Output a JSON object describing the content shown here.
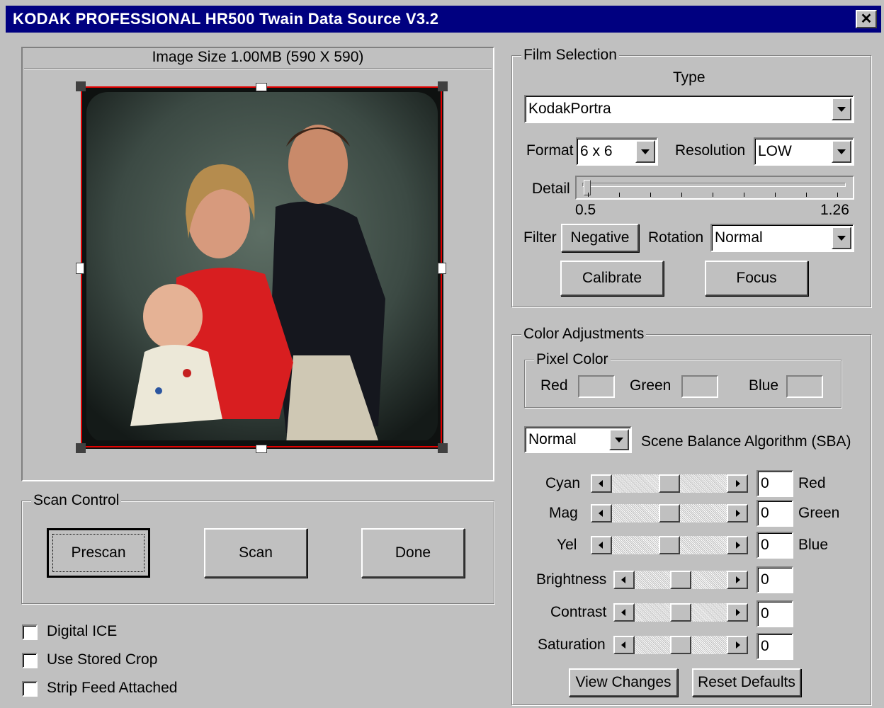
{
  "window": {
    "title": "KODAK PROFESSIONAL HR500 Twain Data Source V3.2",
    "close_glyph": "✕"
  },
  "preview": {
    "image_size_label": "Image Size 1.00MB (590 X 590)"
  },
  "scan_control": {
    "legend": "Scan Control",
    "prescan_label": "Prescan",
    "scan_label": "Scan",
    "done_label": "Done"
  },
  "options": {
    "digital_ice_label": "Digital ICE",
    "digital_ice_checked": false,
    "use_stored_crop_label": "Use Stored Crop",
    "use_stored_crop_checked": false,
    "strip_feed_label": "Strip Feed Attached",
    "strip_feed_checked": false
  },
  "film_selection": {
    "legend": "Film Selection",
    "type_label": "Type",
    "type_value": "KodakPortra",
    "format_label": "Format",
    "format_value": "6 x 6",
    "resolution_label": "Resolution",
    "resolution_value": "LOW",
    "detail_label": "Detail",
    "detail_min": "0.5",
    "detail_max": "1.26",
    "detail_value": 0.5,
    "filter_label": "Filter",
    "filter_button": "Negative",
    "rotation_label": "Rotation",
    "rotation_value": "Normal",
    "calibrate_label": "Calibrate",
    "focus_label": "Focus"
  },
  "color_adjustments": {
    "legend": "Color Adjustments",
    "pixel_color": {
      "legend": "Pixel Color",
      "red_label": "Red",
      "green_label": "Green",
      "blue_label": "Blue"
    },
    "sba_value": "Normal",
    "sba_label": "Scene Balance Algorithm (SBA)",
    "sliders": {
      "cyan": {
        "label": "Cyan",
        "value": "0",
        "right_label": "Red"
      },
      "mag": {
        "label": "Mag",
        "value": "0",
        "right_label": "Green"
      },
      "yel": {
        "label": "Yel",
        "value": "0",
        "right_label": "Blue"
      },
      "brightness": {
        "label": "Brightness",
        "value": "0"
      },
      "contrast": {
        "label": "Contrast",
        "value": "0"
      },
      "saturation": {
        "label": "Saturation",
        "value": "0"
      }
    },
    "view_changes_label": "View Changes",
    "reset_defaults_label": "Reset Defaults"
  }
}
